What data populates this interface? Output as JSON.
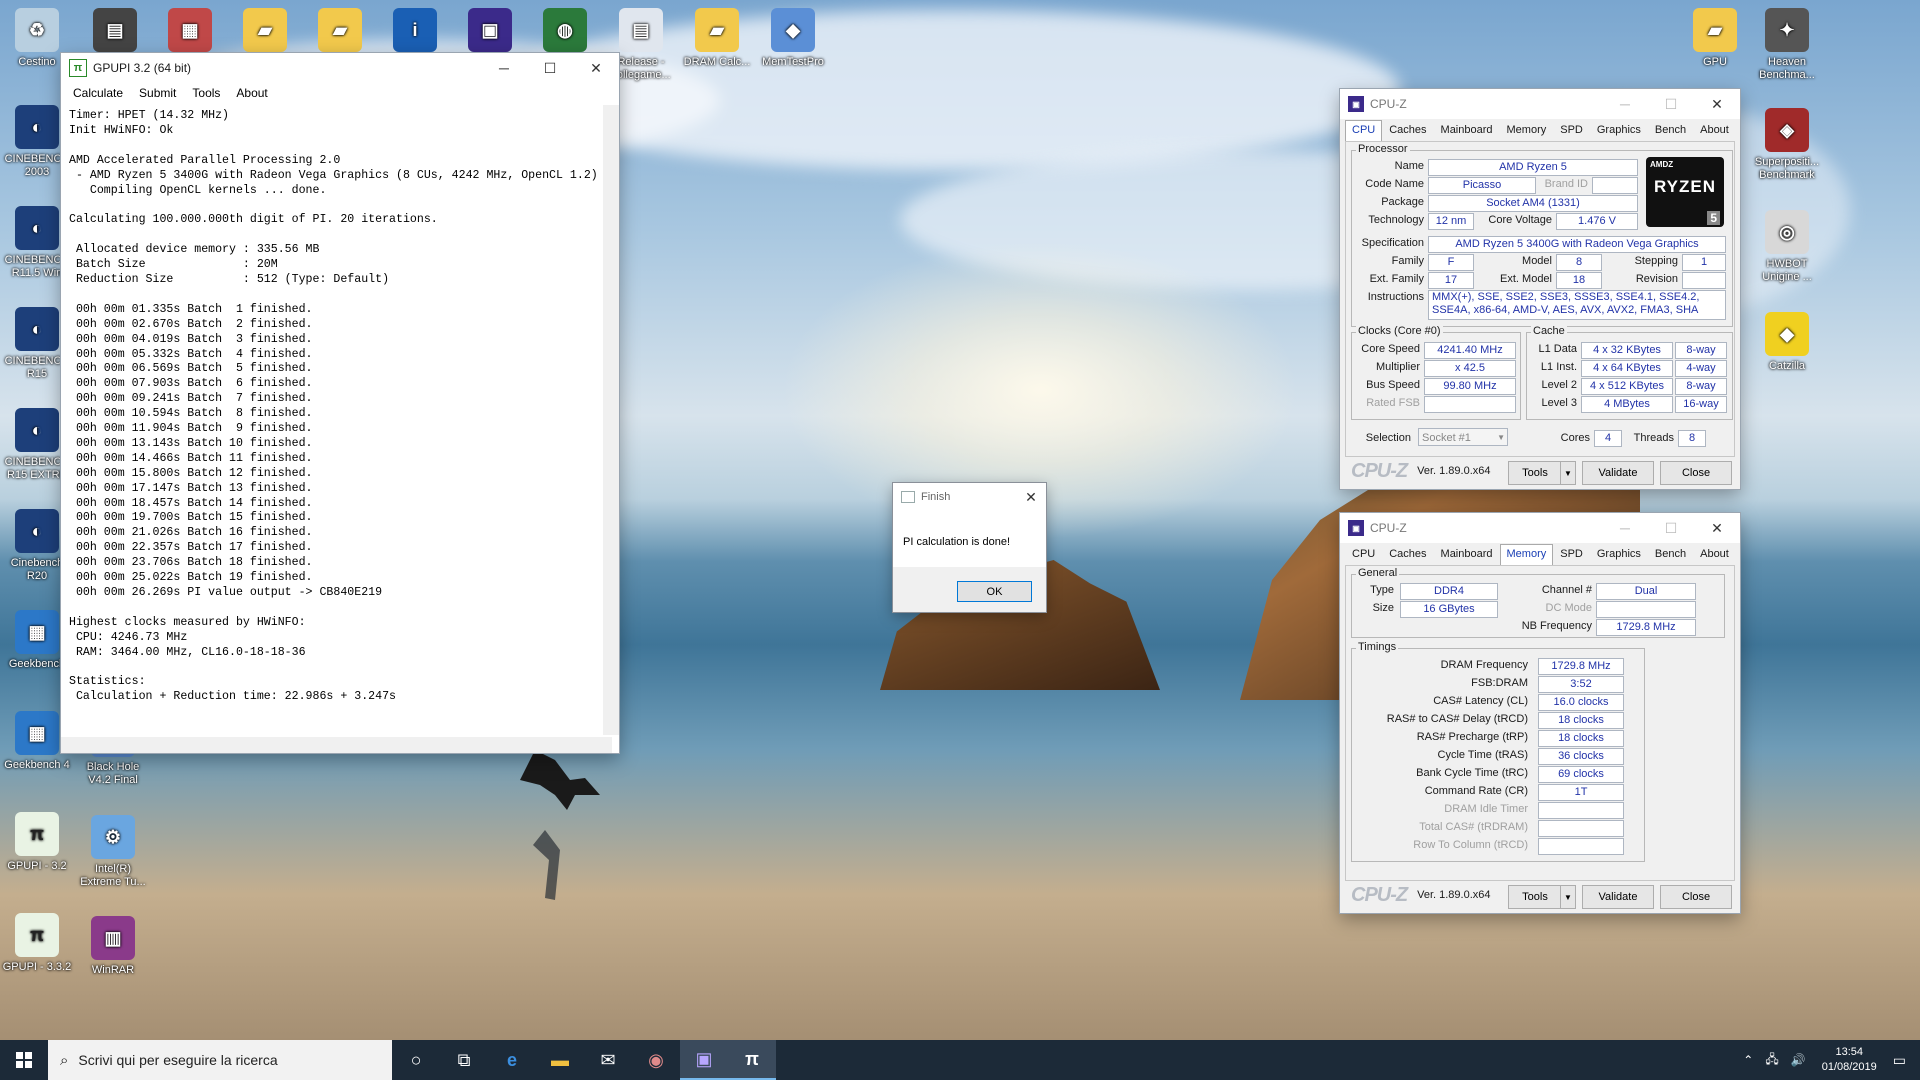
{
  "desktop": {
    "icons_top": [
      {
        "label": "Cestino",
        "icon": "recycle-bin-icon"
      },
      {
        "label": "",
        "icon": "file-icon"
      },
      {
        "label": "",
        "icon": "archive-icon"
      },
      {
        "label": "",
        "icon": "folder-icon"
      },
      {
        "label": "",
        "icon": "folder-icon"
      },
      {
        "label": "",
        "icon": "intel-core-icon"
      },
      {
        "label": "",
        "icon": "chip-icon"
      },
      {
        "label": "",
        "icon": "globe-icon"
      },
      {
        "label": "Release - collegame...",
        "icon": "document-icon"
      },
      {
        "label": "DRAM Calc...",
        "icon": "folder-icon"
      },
      {
        "label": "MemTestPro",
        "icon": "app-icon"
      },
      {
        "label": "GPU",
        "icon": "folder-icon"
      },
      {
        "label": "Heaven Benchma...",
        "icon": "heaven-icon"
      }
    ],
    "icons_left": [
      {
        "label": "CINEBENCH 2003",
        "icon": "cinebench-icon"
      },
      {
        "label": "CINEBENCH R11.5 Win",
        "icon": "cinebench-icon"
      },
      {
        "label": "CINEBENCH R15",
        "icon": "cinebench-icon"
      },
      {
        "label": "CINEBENCH R15 EXTRE",
        "icon": "cinebench-icon"
      },
      {
        "label": "Cinebench R20",
        "icon": "cinebench-icon"
      },
      {
        "label": "Geekbench",
        "icon": "geekbench-icon"
      },
      {
        "label": "Geekbench 4",
        "icon": "geekbench-icon"
      },
      {
        "label": "GPUPI - 3.2",
        "icon": "gpupi-icon"
      },
      {
        "label": "GPUPI - 3.3.2",
        "icon": "gpupi-icon"
      }
    ],
    "icons_left2": [
      {
        "label": "Black Hole V4.2 Final",
        "icon": "app-icon"
      },
      {
        "label": "Intel(R) Extreme Tu...",
        "icon": "intel-xtu-icon"
      },
      {
        "label": "WinRAR",
        "icon": "winrar-icon"
      }
    ],
    "icons_right": [
      {
        "label": "Superpositi... Benchmark",
        "icon": "superposition-icon"
      },
      {
        "label": "HWBOT Unigine ...",
        "icon": "hwbot-icon"
      },
      {
        "label": "Catzilla",
        "icon": "catzilla-icon"
      }
    ]
  },
  "gpupi": {
    "title": "GPUPI 3.2 (64 bit)",
    "menu": [
      "Calculate",
      "Submit",
      "Tools",
      "About"
    ],
    "log": "Timer: HPET (14.32 MHz)\nInit HWiNFO: Ok\n\nAMD Accelerated Parallel Processing 2.0\n - AMD Ryzen 5 3400G with Radeon Vega Graphics (8 CUs, 4242 MHz, OpenCL 1.2)\n   Compiling OpenCL kernels ... done.\n\nCalculating 100.000.000th digit of PI. 20 iterations.\n\n Allocated device memory : 335.56 MB\n Batch Size              : 20M\n Reduction Size          : 512 (Type: Default)\n\n 00h 00m 01.335s Batch  1 finished.\n 00h 00m 02.670s Batch  2 finished.\n 00h 00m 04.019s Batch  3 finished.\n 00h 00m 05.332s Batch  4 finished.\n 00h 00m 06.569s Batch  5 finished.\n 00h 00m 07.903s Batch  6 finished.\n 00h 00m 09.241s Batch  7 finished.\n 00h 00m 10.594s Batch  8 finished.\n 00h 00m 11.904s Batch  9 finished.\n 00h 00m 13.143s Batch 10 finished.\n 00h 00m 14.466s Batch 11 finished.\n 00h 00m 15.800s Batch 12 finished.\n 00h 00m 17.147s Batch 13 finished.\n 00h 00m 18.457s Batch 14 finished.\n 00h 00m 19.700s Batch 15 finished.\n 00h 00m 21.026s Batch 16 finished.\n 00h 00m 22.357s Batch 17 finished.\n 00h 00m 23.706s Batch 18 finished.\n 00h 00m 25.022s Batch 19 finished.\n 00h 00m 26.269s PI value output -> CB840E219\n\nHighest clocks measured by HWiNFO:\n CPU: 4246.73 MHz\n RAM: 3464.00 MHz, CL16.0-18-18-36\n\nStatistics:\n Calculation + Reduction time: 22.986s + 3.247s"
  },
  "dialog": {
    "title": "Finish",
    "message": "PI calculation is done!",
    "ok": "OK"
  },
  "cpuz1": {
    "title": "CPU-Z",
    "tabs": [
      "CPU",
      "Caches",
      "Mainboard",
      "Memory",
      "SPD",
      "Graphics",
      "Bench",
      "About"
    ],
    "active_tab": "CPU",
    "processor_group": "Processor",
    "name_label": "Name",
    "name": "AMD Ryzen 5",
    "codename_label": "Code Name",
    "codename": "Picasso",
    "brandid_label": "Brand ID",
    "package_label": "Package",
    "package": "Socket AM4 (1331)",
    "technology_label": "Technology",
    "technology": "12 nm",
    "corevoltage_label": "Core Voltage",
    "corevoltage": "1.476 V",
    "spec_label": "Specification",
    "spec": "AMD Ryzen 5 3400G with Radeon Vega Graphics",
    "family_label": "Family",
    "family": "F",
    "model_label": "Model",
    "model": "8",
    "stepping_label": "Stepping",
    "stepping": "1",
    "extfamily_label": "Ext. Family",
    "extfamily": "17",
    "extmodel_label": "Ext. Model",
    "extmodel": "18",
    "revision_label": "Revision",
    "revision": "",
    "instructions_label": "Instructions",
    "instructions": "MMX(+), SSE, SSE2, SSE3, SSSE3, SSE4.1, SSE4.2, SSE4A, x86-64, AMD-V, AES, AVX, AVX2, FMA3, SHA",
    "logo_brand": "AMDZ",
    "logo_line": "RYZEN",
    "logo_num": "5",
    "clocks_group": "Clocks (Core #0)",
    "corespeed_label": "Core Speed",
    "corespeed": "4241.40 MHz",
    "multiplier_label": "Multiplier",
    "multiplier": "x 42.5",
    "busspeed_label": "Bus Speed",
    "busspeed": "99.80 MHz",
    "ratedfsb_label": "Rated FSB",
    "ratedfsb": "",
    "cache_group": "Cache",
    "l1d_label": "L1 Data",
    "l1d": "4 x 32 KBytes",
    "l1d_way": "8-way",
    "l1i_label": "L1 Inst.",
    "l1i": "4 x 64 KBytes",
    "l1i_way": "4-way",
    "l2_label": "Level 2",
    "l2": "4 x 512 KBytes",
    "l2_way": "8-way",
    "l3_label": "Level 3",
    "l3": "4 MBytes",
    "l3_way": "16-way",
    "selection_label": "Selection",
    "selection": "Socket #1",
    "cores_label": "Cores",
    "cores": "4",
    "threads_label": "Threads",
    "threads": "8",
    "footer_logo": "CPU-Z",
    "version": "Ver. 1.89.0.x64",
    "tools": "Tools",
    "validate": "Validate",
    "close": "Close"
  },
  "cpuz2": {
    "title": "CPU-Z",
    "tabs": [
      "CPU",
      "Caches",
      "Mainboard",
      "Memory",
      "SPD",
      "Graphics",
      "Bench",
      "About"
    ],
    "active_tab": "Memory",
    "general_group": "General",
    "type_label": "Type",
    "type": "DDR4",
    "size_label": "Size",
    "size": "16 GBytes",
    "channel_label": "Channel #",
    "channel": "Dual",
    "dcmode_label": "DC Mode",
    "dcmode": "",
    "nbfreq_label": "NB Frequency",
    "nbfreq": "1729.8 MHz",
    "timings_group": "Timings",
    "timings": [
      {
        "label": "DRAM Frequency",
        "value": "1729.8 MHz",
        "dim": false
      },
      {
        "label": "FSB:DRAM",
        "value": "3:52",
        "dim": false
      },
      {
        "label": "CAS# Latency (CL)",
        "value": "16.0 clocks",
        "dim": false
      },
      {
        "label": "RAS# to CAS# Delay (tRCD)",
        "value": "18 clocks",
        "dim": false
      },
      {
        "label": "RAS# Precharge (tRP)",
        "value": "18 clocks",
        "dim": false
      },
      {
        "label": "Cycle Time (tRAS)",
        "value": "36 clocks",
        "dim": false
      },
      {
        "label": "Bank Cycle Time (tRC)",
        "value": "69 clocks",
        "dim": false
      },
      {
        "label": "Command Rate (CR)",
        "value": "1T",
        "dim": false
      },
      {
        "label": "DRAM Idle Timer",
        "value": "",
        "dim": true
      },
      {
        "label": "Total CAS# (tRDRAM)",
        "value": "",
        "dim": true
      },
      {
        "label": "Row To Column (tRCD)",
        "value": "",
        "dim": true
      }
    ],
    "footer_logo": "CPU-Z",
    "version": "Ver. 1.89.0.x64",
    "tools": "Tools",
    "validate": "Validate",
    "close": "Close"
  },
  "taskbar": {
    "search_placeholder": "Scrivi qui per eseguire la ricerca",
    "apps": [
      "cortana-icon",
      "task-view-icon",
      "edge-icon",
      "explorer-icon",
      "mail-icon",
      "app-icon",
      "cpuz-icon",
      "gpupi-icon"
    ],
    "time": "13:54",
    "date": "01/08/2019"
  }
}
